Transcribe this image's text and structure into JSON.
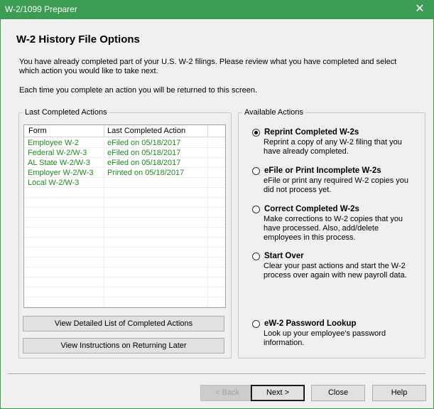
{
  "window": {
    "title": "W-2/1099 Preparer",
    "close_glyph": "✕"
  },
  "page": {
    "heading": "W-2 History File Options",
    "intro": "You have already completed part of your U.S. W-2 filings. Please review what you have completed and select which action you would like to take next.",
    "intro2": "Each time you complete an action you will be returned to this screen."
  },
  "left_group": {
    "label": "Last Completed Actions",
    "columns": [
      "Form",
      "Last Completed Action"
    ],
    "rows": [
      {
        "form": "Employee W-2",
        "action": "eFiled on 05/18/2017"
      },
      {
        "form": "Federal W-2/W-3",
        "action": "eFiled on 05/18/2017"
      },
      {
        "form": "AL State W-2/W-3",
        "action": "eFiled on 05/18/2017"
      },
      {
        "form": "Employer W-2/W-3",
        "action": "Printed on 05/18/2017"
      },
      {
        "form": "Local W-2/W-3",
        "action": ""
      }
    ],
    "btn_details": "View Detailed List of Completed Actions",
    "btn_instructions": "View Instructions on Returning Later"
  },
  "right_group": {
    "label": "Available Actions",
    "options": [
      {
        "title": "Reprint Completed W-2s",
        "desc": "Reprint a copy of any W-2 filing that you have already completed.",
        "selected": true
      },
      {
        "title": "eFile or Print Incomplete W-2s",
        "desc": "eFile or print any required W-2 copies you did not process yet.",
        "selected": false
      },
      {
        "title": "Correct Completed W-2s",
        "desc": "Make corrections to W-2 copies that you have processed. Also, add/delete employees in this process.",
        "selected": false
      },
      {
        "title": "Start Over",
        "desc": "Clear your past actions and start the W-2 process over again with new payroll data.",
        "selected": false
      },
      {
        "title": "eW-2 Password Lookup",
        "desc": "Look up your employee's password information.",
        "selected": false
      }
    ]
  },
  "footer": {
    "back": "< Back",
    "next": "Next >",
    "close": "Close",
    "help": "Help"
  },
  "colors": {
    "titlebar": "#3c9c53",
    "list_text": "#1e8a1e"
  }
}
